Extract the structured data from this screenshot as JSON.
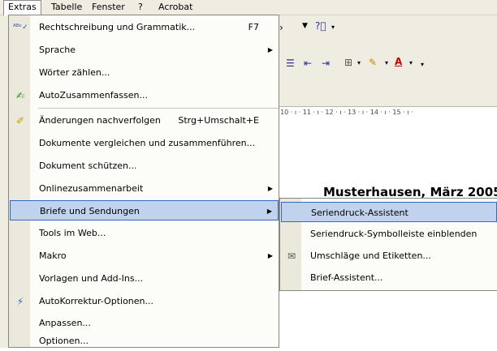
{
  "menubar": {
    "items": [
      {
        "label": "Extras",
        "active": true
      },
      {
        "label": "Tabelle"
      },
      {
        "label": "Fenster"
      },
      {
        "label": "?"
      },
      {
        "label": "Acrobat"
      }
    ]
  },
  "ruler": {
    "text": "· 10 · ı · 11 · ı · 12 · ı · 13 · ı · 14 · ı · 15 · ı ·"
  },
  "document": {
    "heading": "Musterhausen, März 2005"
  },
  "extras_menu": {
    "items": [
      {
        "label": "Rechtschreibung und Grammatik...",
        "shortcut": "F7",
        "icon": "spellcheck-icon"
      },
      {
        "label": "Sprache",
        "submenu": true
      },
      {
        "label": "Wörter zählen..."
      },
      {
        "label": "AutoZusammenfassen...",
        "icon": "autosummarize-icon"
      },
      {
        "label": "Änderungen nachverfolgen",
        "shortcut": "Strg+Umschalt+E",
        "icon": "track-changes-icon"
      },
      {
        "label": "Dokumente vergleichen und zusammenführen..."
      },
      {
        "label": "Dokument schützen..."
      },
      {
        "label": "Onlinezusammenarbeit",
        "submenu": true
      },
      {
        "label": "Briefe und Sendungen",
        "submenu": true,
        "highlighted": true
      },
      {
        "label": "Tools im Web..."
      },
      {
        "label": "Makro",
        "submenu": true
      },
      {
        "label": "Vorlagen und Add-Ins..."
      },
      {
        "label": "AutoKorrektur-Optionen...",
        "icon": "autocorrect-icon"
      },
      {
        "label": "Anpassen..."
      },
      {
        "label": "Optionen..."
      }
    ]
  },
  "letters_submenu": {
    "items": [
      {
        "label": "Seriendruck-Assistent",
        "highlighted": true
      },
      {
        "label": "Seriendruck-Symbolleiste einblenden"
      },
      {
        "label": "Umschläge und Etiketten...",
        "icon": "envelope-icon"
      },
      {
        "label": "Brief-Assistent..."
      }
    ]
  },
  "colors": {
    "highlight": "#c1d2ee",
    "highlight_border": "#316ac5",
    "menu_bg": "#fcfcf9",
    "icon_column": "#ebe8dc"
  }
}
